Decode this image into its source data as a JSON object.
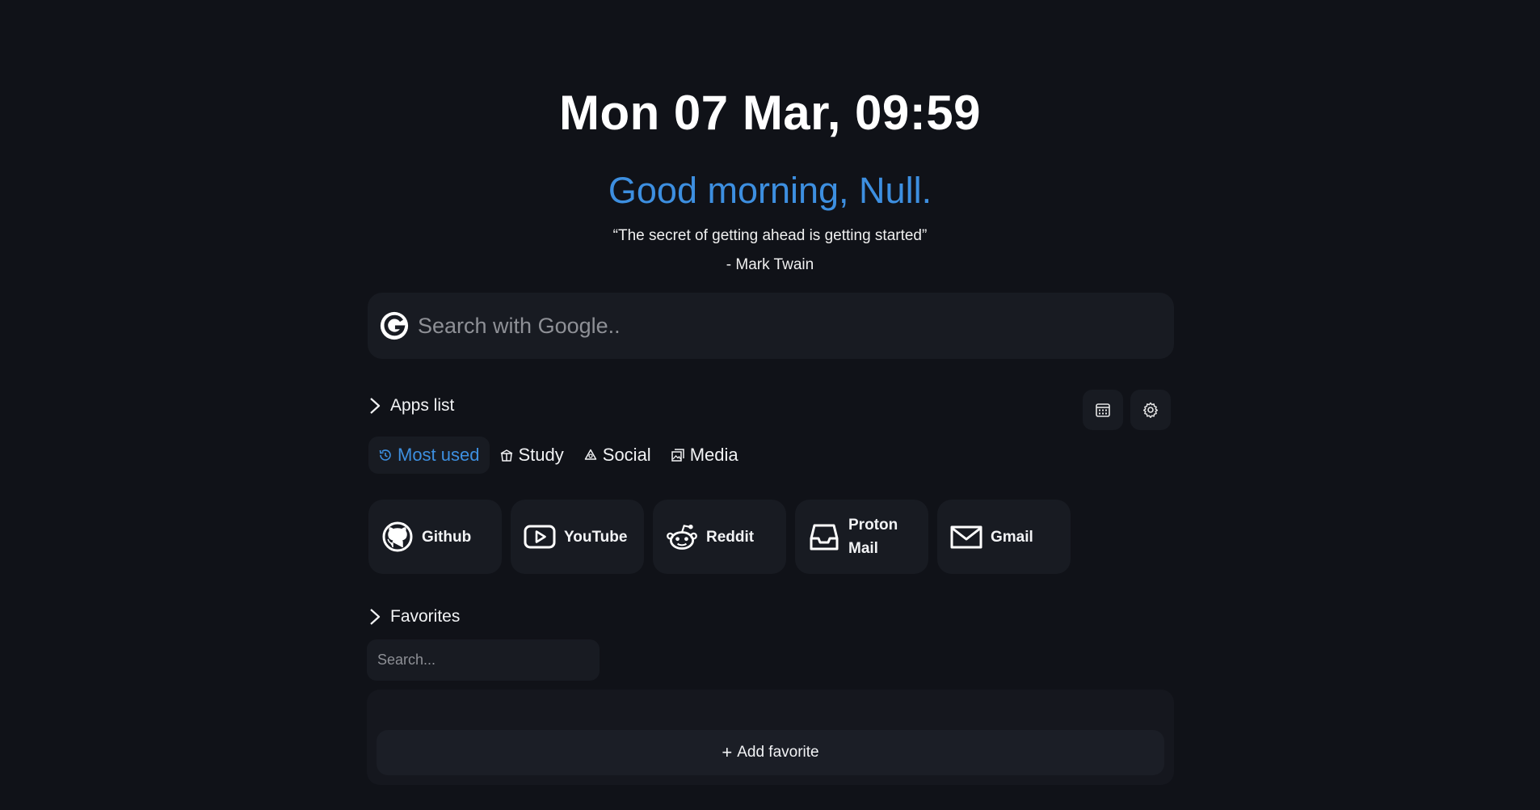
{
  "header": {
    "clock": "Mon 07 Mar, 09:59",
    "greeting": "Good morning, Null.",
    "quote": "“The secret of getting ahead is getting started”",
    "author": "- Mark Twain"
  },
  "search": {
    "placeholder": "Search with Google..",
    "icon": "google-icon"
  },
  "apps_section": {
    "title": "Apps list",
    "tools": [
      {
        "icon": "calendar-icon"
      },
      {
        "icon": "gear-icon"
      }
    ],
    "tabs": [
      {
        "label": "Most used",
        "icon": "history-icon",
        "active": true
      },
      {
        "label": "Study",
        "icon": "box-icon",
        "active": false
      },
      {
        "label": "Social",
        "icon": "recycle-icon",
        "active": false
      },
      {
        "label": "Media",
        "icon": "images-icon",
        "active": false
      }
    ],
    "apps": [
      {
        "label": "Github",
        "icon": "github-icon"
      },
      {
        "label": "YouTube",
        "icon": "youtube-icon"
      },
      {
        "label": "Reddit",
        "icon": "reddit-icon"
      },
      {
        "label": "Proton Mail",
        "icon": "inbox-icon"
      },
      {
        "label": "Gmail",
        "icon": "mail-icon"
      }
    ]
  },
  "favorites": {
    "title": "Favorites",
    "search_placeholder": "Search...",
    "add_label": "Add favorite"
  },
  "colors": {
    "background": "#101218",
    "card": "#181b22",
    "accent": "#3d8fe0"
  }
}
